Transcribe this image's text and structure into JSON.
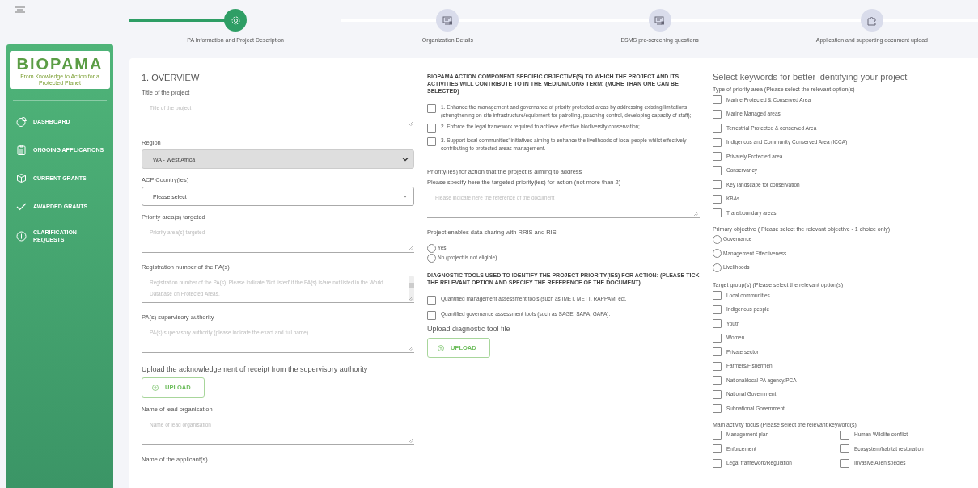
{
  "sidebar": {
    "logo": {
      "title": "BIOPAMA",
      "tagline": "From Knowledge to Action for a Protected Planet"
    },
    "items": [
      {
        "label": "DASHBOARD",
        "selected": false
      },
      {
        "label": "ONGOING APPLICATIONS",
        "selected": false
      },
      {
        "label": "CURRENT GRANTS",
        "selected": false
      },
      {
        "label": "AWARDED GRANTS",
        "selected": false
      },
      {
        "label": "CLARIFICATION REQUESTS",
        "selected": false
      }
    ]
  },
  "steps": [
    {
      "label": "PA Information and Project Description",
      "selected": true
    },
    {
      "label": "Organization Details",
      "selected": false
    },
    {
      "label": "ESMS pre-screening questions",
      "selected": false
    },
    {
      "label": "Application and supporting document upload",
      "selected": false
    }
  ],
  "overview": {
    "title": "1. OVERVIEW",
    "fields": [
      {
        "kind": "textarea",
        "label": "Title of the project",
        "placeholder": "Title of the project",
        "scrollbar": false
      },
      {
        "kind": "select",
        "label": "Region",
        "value": "WA - West Africa"
      },
      {
        "kind": "dropdown",
        "label": "ACP Country(ies)",
        "placeholder": "Please select"
      },
      {
        "kind": "textarea",
        "label": "Priority area(s) targeted",
        "placeholder": "Priority area(s) targeted",
        "scrollbar": false
      },
      {
        "kind": "textarea",
        "label": "Registration number of the PA(s)",
        "placeholder": "Registration number of the PA(s). Please indicate 'Not listed' if the PA(s) is/are not listed in the World Database on Protected Areas.",
        "scrollbar": true
      },
      {
        "kind": "textarea",
        "label": "PA(s) supervisory authority",
        "placeholder": "PA(s) supervisory authority (please indicate the exact and full name)",
        "scrollbar": false
      },
      {
        "kind": "upload",
        "label": "Upload the acknowledgement of receipt from the supervisory authority",
        "button": "UPLOAD"
      },
      {
        "kind": "textarea",
        "label": "Name of lead organisation",
        "placeholder": "Name of lead organisation",
        "scrollbar": false
      },
      {
        "kind": "label",
        "label": "Name of the applicant(s)"
      }
    ]
  },
  "objectives": {
    "heading": "BIOPAMA ACTION COMPONENT SPECIFIC OBJECTIVE(S) TO WHICH THE PROJECT AND ITS ACTIVITIES WILL CONTRIBUTE TO IN THE MEDIUM/LONG TERM: (MORE THAN ONE CAN BE SELECTED)",
    "options": [
      {
        "label": "1. Enhance the management and governance of priority protected areas by addressing existing limitations (strengthening on-site infrastructure/equipment for patrolling, poaching control, developing capacity of staff);",
        "checked": false
      },
      {
        "label": "2. Enforce the legal framework required to achieve effective biodiversity conservation;",
        "checked": false
      },
      {
        "label": "3. Support local communities' initiatives aiming to enhance the livelihoods of local people whilst effectively contributing to protected areas management.",
        "checked": false
      }
    ]
  },
  "priorities": {
    "label": "Priority(ies) for action that the project is aiming to address",
    "sublabel": "Please specify here the targeted priority(ies) for action (not more than 2)",
    "placeholder": "Please indicate here the reference of the document"
  },
  "data_sharing": {
    "label": "Project enables data sharing with RRIS and RIS",
    "options": [
      {
        "label": "Yes",
        "selected": false
      },
      {
        "label": "No (project is not eligible)",
        "selected": false
      }
    ]
  },
  "diagnostic": {
    "heading": "DIAGNOSTIC TOOLS USED TO IDENTIFY THE PROJECT PRIORITY(IES) FOR ACTION: (PLEASE TICK THE RELEVANT OPTION AND SPECIFY THE REFERENCE OF THE DOCUMENT)",
    "options": [
      {
        "label": "Quantified management assessment tools (such as IMET, METT, RAPPAM, ect.",
        "checked": false
      },
      {
        "label": "Quantified governance assessment tools (such as SAGE, SAPA, GAPA).",
        "checked": false
      }
    ],
    "upload_label": "Upload diagnostic tool file",
    "button": "UPLOAD"
  },
  "keywords": {
    "title": "Select keywords for better identifying your project",
    "groups": [
      {
        "kind": "checkbox",
        "label": "Type of priority area (Please select the relevant option(s)",
        "options": [
          {
            "label": "Marine Protected & Conserved Area",
            "checked": false
          },
          {
            "label": "Marine Managed areas",
            "checked": false
          },
          {
            "label": "Terrestrial Protected & conserved Area",
            "checked": false
          },
          {
            "label": "Indigenous and Community Conserved Area (ICCA)",
            "checked": false
          },
          {
            "label": "Privately Protected area",
            "checked": false
          },
          {
            "label": "Conservancy",
            "checked": false
          },
          {
            "label": "Key landscape for conservation",
            "checked": false
          },
          {
            "label": "KBAs",
            "checked": false
          },
          {
            "label": "Transboundary areas",
            "checked": false
          }
        ]
      },
      {
        "kind": "radio",
        "label": "Primary objective ( Please select the relevant objective - 1 choice only)",
        "options": [
          {
            "label": "Governance",
            "selected": false
          },
          {
            "label": "Management Effectiveness",
            "selected": false
          },
          {
            "label": "Livelihoods",
            "selected": false
          }
        ]
      },
      {
        "kind": "checkbox",
        "label": "Target group(s) (Please select the relevant option(s)",
        "options": [
          {
            "label": "Local communities",
            "checked": false
          },
          {
            "label": "Indigenous people",
            "checked": false
          },
          {
            "label": "Youth",
            "checked": false
          },
          {
            "label": "Women",
            "checked": false
          },
          {
            "label": "Private sector",
            "checked": false
          },
          {
            "label": "Farmers/Fishermen",
            "checked": false
          },
          {
            "label": "National/local PA agency/PCA",
            "checked": false
          },
          {
            "label": "National Government",
            "checked": false
          },
          {
            "label": "Subnational Government",
            "checked": false
          }
        ]
      },
      {
        "kind": "checkbox-grid",
        "label": "Main activity focus (Please select the relevant keyword(s)",
        "options": [
          {
            "label": "Management plan",
            "checked": false
          },
          {
            "label": "Human-Wildlife conflict",
            "checked": false
          },
          {
            "label": "Enforcement",
            "checked": false
          },
          {
            "label": "Ecosystem/habitat restoration",
            "checked": false
          },
          {
            "label": "Legal framework/Regulation",
            "checked": false
          },
          {
            "label": "Invasive Alien species",
            "checked": false
          }
        ]
      }
    ]
  }
}
